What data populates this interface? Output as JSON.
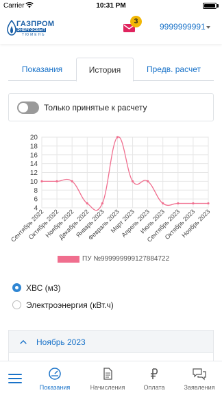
{
  "status_bar": {
    "carrier": "Carrier",
    "time": "10:31 PM"
  },
  "header": {
    "logo": {
      "line1": "ГАЗПРОМ",
      "line2": "ЭНЕРГОСБЫТ",
      "line3": "ТЮМЕНЬ"
    },
    "mail_badge": "3",
    "account_number": "9999999991",
    "colors": {
      "brand": "#1a5fa6",
      "badge": "#f2b705"
    },
    "icons": {
      "mail": "envelope-icon",
      "account_caret": "caret-down-icon"
    }
  },
  "tabs": [
    {
      "label": "Показания",
      "active": false
    },
    {
      "label": "История",
      "active": true
    },
    {
      "label": "Предв. расчет",
      "active": false
    }
  ],
  "filter_toggle": {
    "label": "Только принятые к расчету",
    "on": false
  },
  "chart_data": {
    "type": "line",
    "categories": [
      "Сентябрь 2022",
      "Октябрь 2022",
      "Ноябрь 2022",
      "Декабрь 2022",
      "Январь 2023",
      "Февраль 2023",
      "Март 2023",
      "Апрель 2023",
      "Июль 2023",
      "Сентябрь 2023",
      "Октябрь 2023",
      "Ноябрь 2023"
    ],
    "series": [
      {
        "name": "ПУ №999999999127884722",
        "color": "#f06e8e",
        "values": [
          10,
          10,
          10,
          5,
          5,
          20,
          10,
          10,
          5,
          5,
          5,
          5
        ]
      }
    ],
    "ylim": [
      4,
      20
    ],
    "yticks": [
      4,
      6,
      8,
      10,
      12,
      14,
      16,
      18,
      20
    ],
    "grid": true,
    "legend_position": "bottom"
  },
  "meter_types": [
    {
      "label": "ХВС (м3)",
      "selected": true
    },
    {
      "label": "Электроэнергия (кВт.ч)",
      "selected": false
    }
  ],
  "accordion": {
    "label": "Ноябрь 2023",
    "expanded": true,
    "icon": "chevron-up-icon"
  },
  "bottom_nav": [
    {
      "label": "",
      "icon": "menu-icon",
      "active": false
    },
    {
      "label": "Показания",
      "icon": "gauge-icon",
      "active": true
    },
    {
      "label": "Начисления",
      "icon": "document-icon",
      "active": false
    },
    {
      "label": "Оплата",
      "icon": "ruble-icon",
      "active": false
    },
    {
      "label": "Заявления",
      "icon": "chat-icon",
      "active": false
    }
  ],
  "accent_color": "#1a73c9"
}
